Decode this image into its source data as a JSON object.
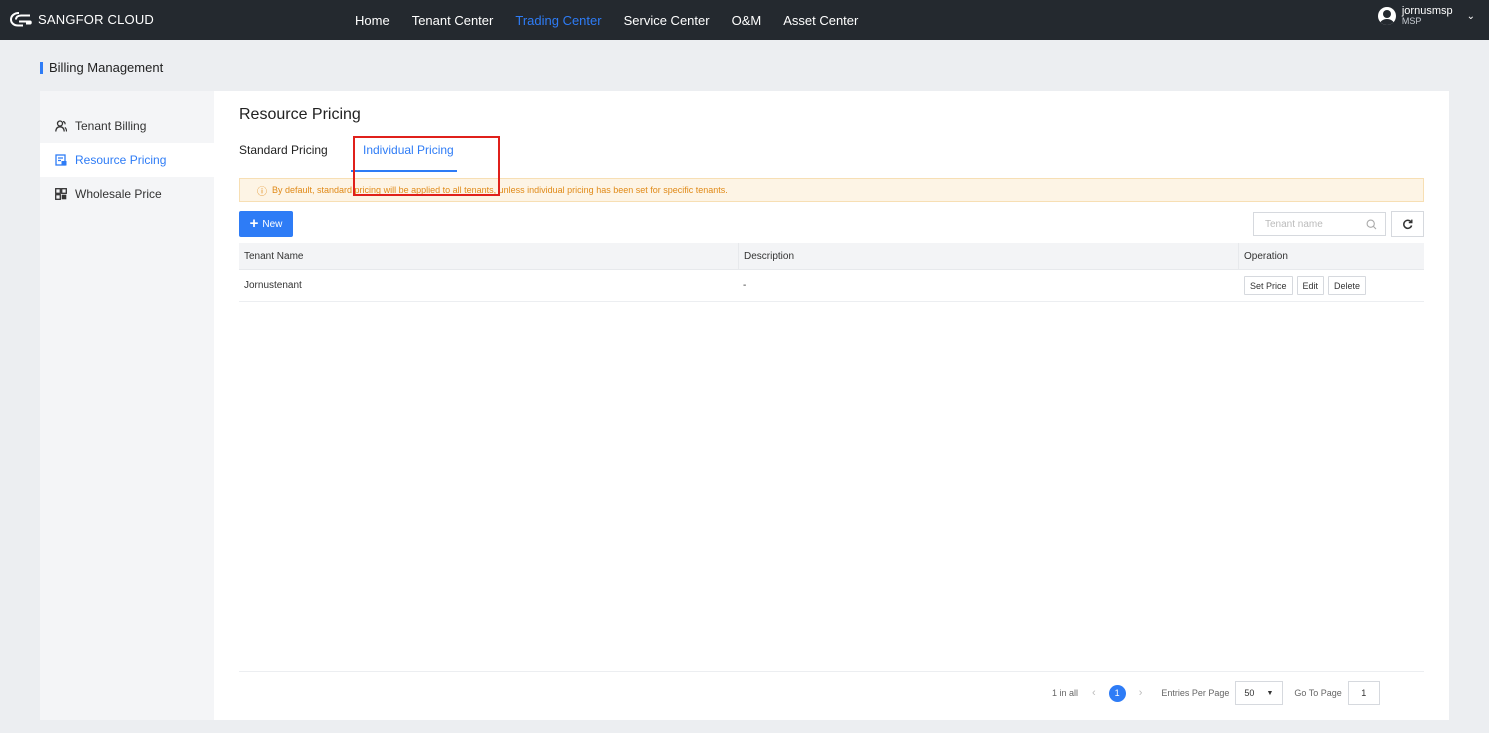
{
  "app": {
    "logo_text": "SANGFOR CLOUD"
  },
  "nav": {
    "items": [
      {
        "label": "Home"
      },
      {
        "label": "Tenant Center"
      },
      {
        "label": "Trading Center"
      },
      {
        "label": "Service Center"
      },
      {
        "label": "O&M"
      },
      {
        "label": "Asset Center"
      }
    ],
    "active": "Trading Center"
  },
  "user": {
    "name": "jornusmsp",
    "role": "MSP",
    "icons": {
      "avatar": "user-avatar-icon",
      "chevron": "chevron-down-icon"
    }
  },
  "page": {
    "title": "Billing Management"
  },
  "sidebar": {
    "items": [
      {
        "label": "Tenant Billing",
        "icon": "tenant-billing-icon"
      },
      {
        "label": "Resource Pricing",
        "icon": "resource-pricing-icon"
      },
      {
        "label": "Wholesale Price",
        "icon": "wholesale-price-icon"
      }
    ],
    "active": "Resource Pricing"
  },
  "main": {
    "title": "Resource Pricing",
    "tabs": [
      {
        "label": "Standard Pricing"
      },
      {
        "label": "Individual Pricing"
      }
    ],
    "active_tab": "Individual Pricing",
    "notice": {
      "icon": "info-icon",
      "text": "By default, standard pricing will be applied to all tenants, unless individual pricing has been set for specific tenants."
    },
    "new_button": "New",
    "search": {
      "placeholder": "Tenant name",
      "value": ""
    },
    "table": {
      "columns": [
        "Tenant Name",
        "Description",
        "Operation"
      ],
      "rows": [
        {
          "tenant_name": "Jornustenant",
          "description": "-",
          "operations": [
            "Set Price",
            "Edit",
            "Delete"
          ]
        }
      ]
    },
    "pagination": {
      "total_text": "1 in all",
      "current_page": "1",
      "entries_label": "Entries Per Page",
      "entries_per_page": "50",
      "goto_label": "Go To Page",
      "goto_value": "1"
    }
  },
  "colors": {
    "accent": "#2e7cf6",
    "topbar": "#24292f",
    "notice_text": "#e08a18",
    "highlight": "#e0201b"
  }
}
